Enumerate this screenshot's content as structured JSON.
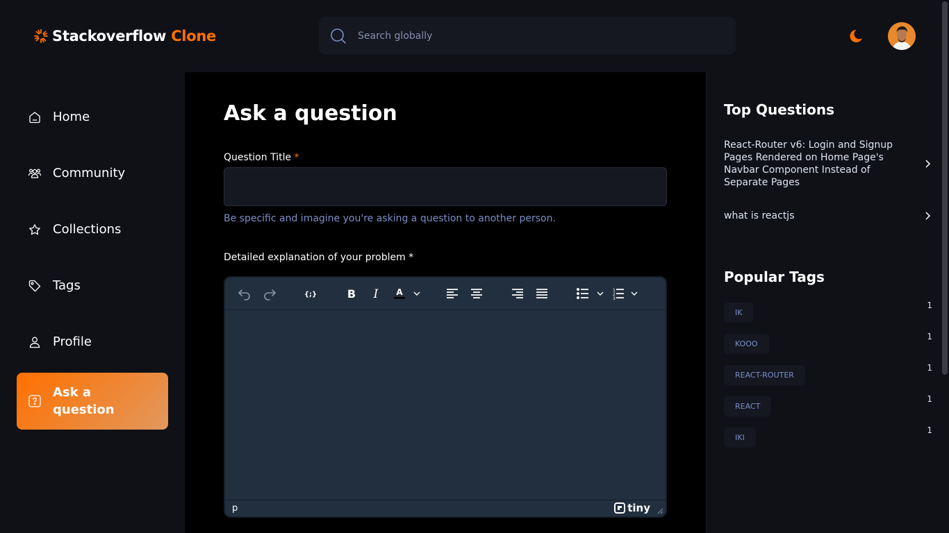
{
  "header": {
    "logo_main": "Stackoverflow",
    "logo_accent": "Clone",
    "search_placeholder": "Search globally"
  },
  "sidebar": {
    "items": [
      {
        "label": "Home",
        "icon": "home-icon"
      },
      {
        "label": "Community",
        "icon": "users-icon"
      },
      {
        "label": "Collections",
        "icon": "star-icon"
      },
      {
        "label": "Tags",
        "icon": "tag-icon"
      },
      {
        "label": "Profile",
        "icon": "user-icon"
      },
      {
        "label": "Ask a question",
        "icon": "question-icon",
        "active": true
      }
    ]
  },
  "main": {
    "title": "Ask a question",
    "question_title_label": "Question Title",
    "required_mark": "*",
    "question_title_value": "",
    "question_title_hint": "Be specific and imagine you're asking a question to another person.",
    "explanation_label": "Detailed explanation of your problem",
    "editor": {
      "toolbar": [
        "undo",
        "redo",
        "codesample",
        "bold",
        "italic",
        "text-color",
        "align-left",
        "align-center",
        "align-right",
        "align-justify",
        "bullet-list",
        "numbered-list"
      ],
      "status_path": "p",
      "brand": "tiny"
    }
  },
  "rightbar": {
    "top_questions_title": "Top Questions",
    "questions": [
      "React-Router v6: Login and Signup Pages Rendered on Home Page's Navbar Component Instead of Separate Pages",
      "what is reactjs"
    ],
    "popular_tags_title": "Popular Tags",
    "tags": [
      {
        "name": "IK",
        "count": "1"
      },
      {
        "name": "KOOO",
        "count": "1"
      },
      {
        "name": "REACT-ROUTER",
        "count": "1"
      },
      {
        "name": "REACT",
        "count": "1"
      },
      {
        "name": "IKI",
        "count": "1"
      }
    ]
  },
  "colors": {
    "accent": "#ff7000",
    "background": "#0f1117",
    "main_background": "#000000",
    "input_background": "#151821",
    "editor_background": "#222f3e",
    "hint": "#7b8ec8"
  }
}
